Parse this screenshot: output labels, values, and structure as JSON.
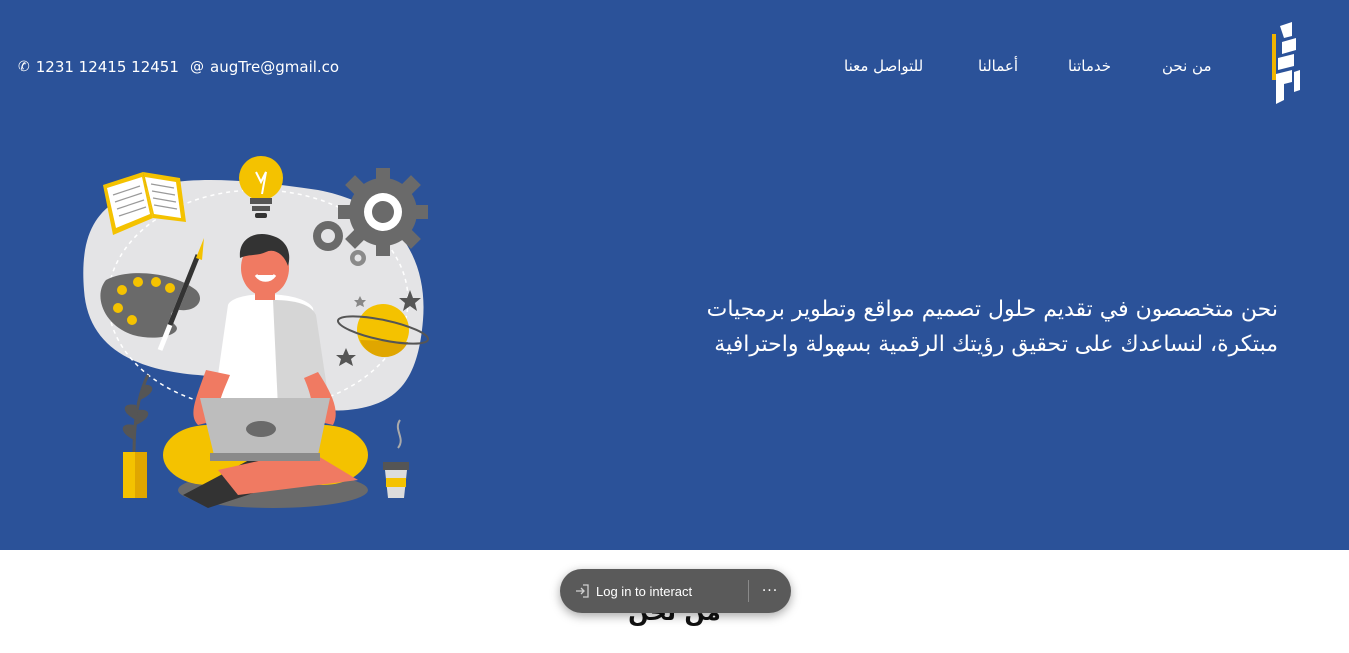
{
  "nav": {
    "logo_alt": "logo",
    "links": [
      "من نحن",
      "خدماتنا",
      "أعمالنا",
      "للتواصل معنا"
    ]
  },
  "contact": {
    "email": "augTre@gmail.co",
    "phone": "1231 12415 12451",
    "email_icon": "at-icon",
    "phone_icon": "phone-icon"
  },
  "hero": {
    "headline": "نحن متخصصون في تقديم حلول تصميم مواقع وتطوير برمجيات مبتكرة، لنساعدك على تحقيق رؤيتك الرقمية بسهولة واحترافية"
  },
  "section": {
    "title": "من نحن"
  },
  "overlay": {
    "login_label": "Log in to interact",
    "more_label": "···"
  },
  "colors": {
    "hero_bg": "#2b5299",
    "accent": "#f0b400",
    "text_light": "#ffffff"
  }
}
